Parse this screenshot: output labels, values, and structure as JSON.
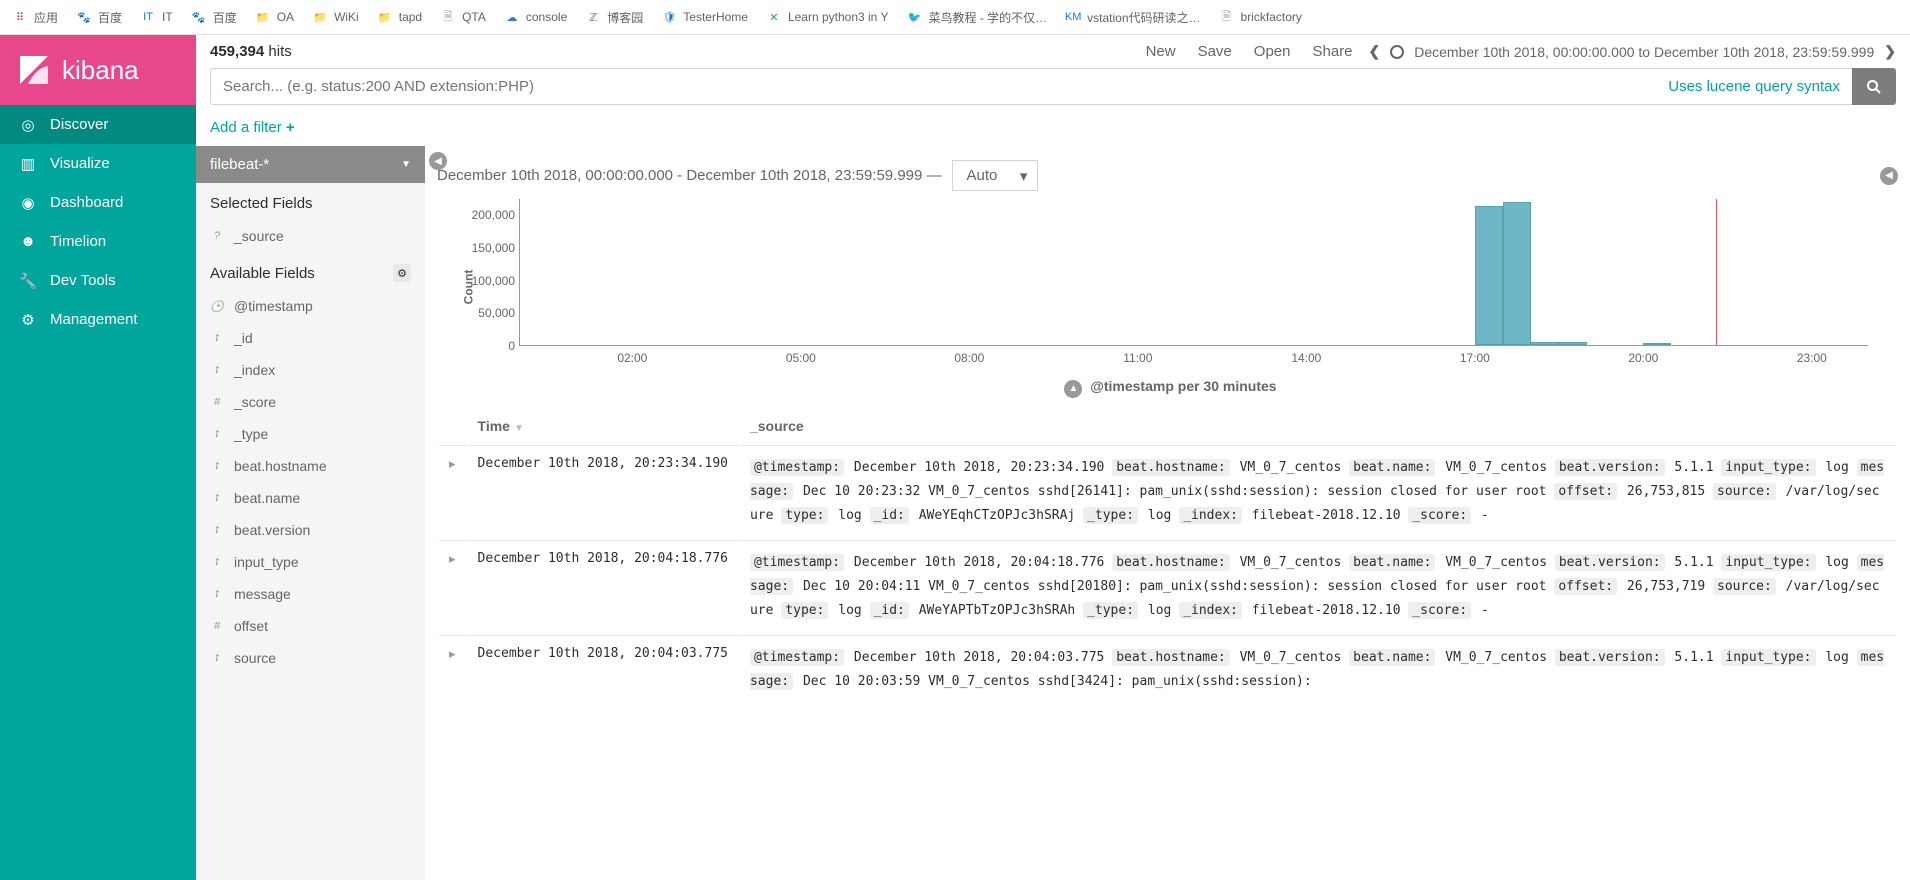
{
  "bookmarks": [
    {
      "label": "应用",
      "icon": "apps",
      "color": "#d93025"
    },
    {
      "label": "百度",
      "icon": "paw",
      "color": "#3b78e7"
    },
    {
      "label": "IT",
      "icon": "it",
      "color": "#1a73e8"
    },
    {
      "label": "百度",
      "icon": "paw",
      "color": "#3b78e7"
    },
    {
      "label": "OA",
      "icon": "folder",
      "color": "#f5c518"
    },
    {
      "label": "WiKi",
      "icon": "folder",
      "color": "#f5c518"
    },
    {
      "label": "tapd",
      "icon": "folder",
      "color": "#f5c518"
    },
    {
      "label": "QTA",
      "icon": "file",
      "color": "#999"
    },
    {
      "label": "console",
      "icon": "cloud",
      "color": "#3b78e7"
    },
    {
      "label": "博客园",
      "icon": "zhi",
      "color": "#5f6368"
    },
    {
      "label": "TesterHome",
      "icon": "shield",
      "color": "#1a73e8"
    },
    {
      "label": "Learn python3 in Y",
      "icon": "x",
      "color": "#34a853"
    },
    {
      "label": "菜鸟教程 - 学的不仅…",
      "icon": "bird",
      "color": "#d93025"
    },
    {
      "label": "vstation代码研读之…",
      "icon": "km",
      "color": "#1a73e8"
    },
    {
      "label": "brickfactory",
      "icon": "file",
      "color": "#999"
    }
  ],
  "logo_text": "kibana",
  "nav": [
    {
      "label": "Discover",
      "icon": "compass"
    },
    {
      "label": "Visualize",
      "icon": "bar-chart"
    },
    {
      "label": "Dashboard",
      "icon": "gauge"
    },
    {
      "label": "Timelion",
      "icon": "bear"
    },
    {
      "label": "Dev Tools",
      "icon": "wrench"
    },
    {
      "label": "Management",
      "icon": "gear"
    }
  ],
  "hits_count": "459,394",
  "hits_label": "hits",
  "top_actions": [
    "New",
    "Save",
    "Open",
    "Share"
  ],
  "time_range_label": "December 10th 2018, 00:00:00.000 to December 10th 2018, 23:59:59.999",
  "search_placeholder": "Search... (e.g. status:200 AND extension:PHP)",
  "lucene_label": "Uses lucene query syntax",
  "add_filter_label": "Add a filter",
  "index_pattern": "filebeat-*",
  "selected_fields_title": "Selected Fields",
  "selected_fields": [
    {
      "type": "?",
      "name": "_source"
    }
  ],
  "available_fields_title": "Available Fields",
  "available_fields": [
    {
      "type": "🕑",
      "name": "@timestamp"
    },
    {
      "type": "t",
      "name": "_id"
    },
    {
      "type": "t",
      "name": "_index"
    },
    {
      "type": "#",
      "name": "_score"
    },
    {
      "type": "t",
      "name": "_type"
    },
    {
      "type": "t",
      "name": "beat.hostname"
    },
    {
      "type": "t",
      "name": "beat.name"
    },
    {
      "type": "t",
      "name": "beat.version"
    },
    {
      "type": "t",
      "name": "input_type"
    },
    {
      "type": "t",
      "name": "message"
    },
    {
      "type": "#",
      "name": "offset"
    },
    {
      "type": "t",
      "name": "source"
    }
  ],
  "hist_range_label": "December 10th 2018, 00:00:00.000 - December 10th 2018, 23:59:59.999 —",
  "interval_label": "Auto",
  "chart_caption": "@timestamp per 30 minutes",
  "chart_data": {
    "type": "bar",
    "ylabel": "Count",
    "ylim": [
      0,
      225000
    ],
    "y_ticks": [
      0,
      50000,
      100000,
      150000,
      200000
    ],
    "x_ticks": [
      "02:00",
      "05:00",
      "08:00",
      "11:00",
      "14:00",
      "17:00",
      "20:00",
      "23:00"
    ],
    "x_domain": [
      0,
      24
    ],
    "bars": [
      {
        "x": 17.0,
        "value": 215000
      },
      {
        "x": 17.5,
        "value": 220000
      },
      {
        "x": 18.0,
        "value": 5000
      },
      {
        "x": 18.5,
        "value": 4000
      },
      {
        "x": 20.0,
        "value": 3000
      }
    ],
    "cursor_x": 21.3
  },
  "table": {
    "col_time": "Time",
    "col_source": "_source",
    "rows": [
      {
        "time": "December 10th 2018, 20:23:34.190",
        "fields": [
          {
            "k": "@timestamp:",
            "v": "December 10th 2018, 20:23:34.190"
          },
          {
            "k": "beat.hostname:",
            "v": "VM_0_7_centos"
          },
          {
            "k": "beat.name:",
            "v": "VM_0_7_centos"
          },
          {
            "k": "beat.version:",
            "v": "5.1.1"
          },
          {
            "k": "input_type:",
            "v": "log"
          },
          {
            "k": "message:",
            "v": "Dec 10 20:23:32 VM_0_7_centos sshd[26141]: pam_unix(sshd:session): session closed for user root"
          },
          {
            "k": "offset:",
            "v": "26,753,815"
          },
          {
            "k": "source:",
            "v": "/var/log/secure"
          },
          {
            "k": "type:",
            "v": "log"
          },
          {
            "k": "_id:",
            "v": "AWeYEqhCTzOPJc3hSRAj"
          },
          {
            "k": "_type:",
            "v": "log"
          },
          {
            "k": "_index:",
            "v": "filebeat-2018.12.10"
          },
          {
            "k": "_score:",
            "v": " -"
          }
        ]
      },
      {
        "time": "December 10th 2018, 20:04:18.776",
        "fields": [
          {
            "k": "@timestamp:",
            "v": "December 10th 2018, 20:04:18.776"
          },
          {
            "k": "beat.hostname:",
            "v": "VM_0_7_centos"
          },
          {
            "k": "beat.name:",
            "v": "VM_0_7_centos"
          },
          {
            "k": "beat.version:",
            "v": "5.1.1"
          },
          {
            "k": "input_type:",
            "v": "log"
          },
          {
            "k": "message:",
            "v": "Dec 10 20:04:11 VM_0_7_centos sshd[20180]: pam_unix(sshd:session): session closed for user root"
          },
          {
            "k": "offset:",
            "v": "26,753,719"
          },
          {
            "k": "source:",
            "v": "/var/log/secure"
          },
          {
            "k": "type:",
            "v": "log"
          },
          {
            "k": "_id:",
            "v": "AWeYAPTbTzOPJc3hSRAh"
          },
          {
            "k": "_type:",
            "v": "log"
          },
          {
            "k": "_index:",
            "v": "filebeat-2018.12.10"
          },
          {
            "k": "_score:",
            "v": " -"
          }
        ]
      },
      {
        "time": "December 10th 2018, 20:04:03.775",
        "fields": [
          {
            "k": "@timestamp:",
            "v": "December 10th 2018, 20:04:03.775"
          },
          {
            "k": "beat.hostname:",
            "v": "VM_0_7_centos"
          },
          {
            "k": "beat.name:",
            "v": "VM_0_7_centos"
          },
          {
            "k": "beat.version:",
            "v": "5.1.1"
          },
          {
            "k": "input_type:",
            "v": "log"
          },
          {
            "k": "message:",
            "v": "Dec 10 20:03:59 VM_0_7_centos sshd[3424]: pam_unix(sshd:session):"
          }
        ]
      }
    ]
  }
}
